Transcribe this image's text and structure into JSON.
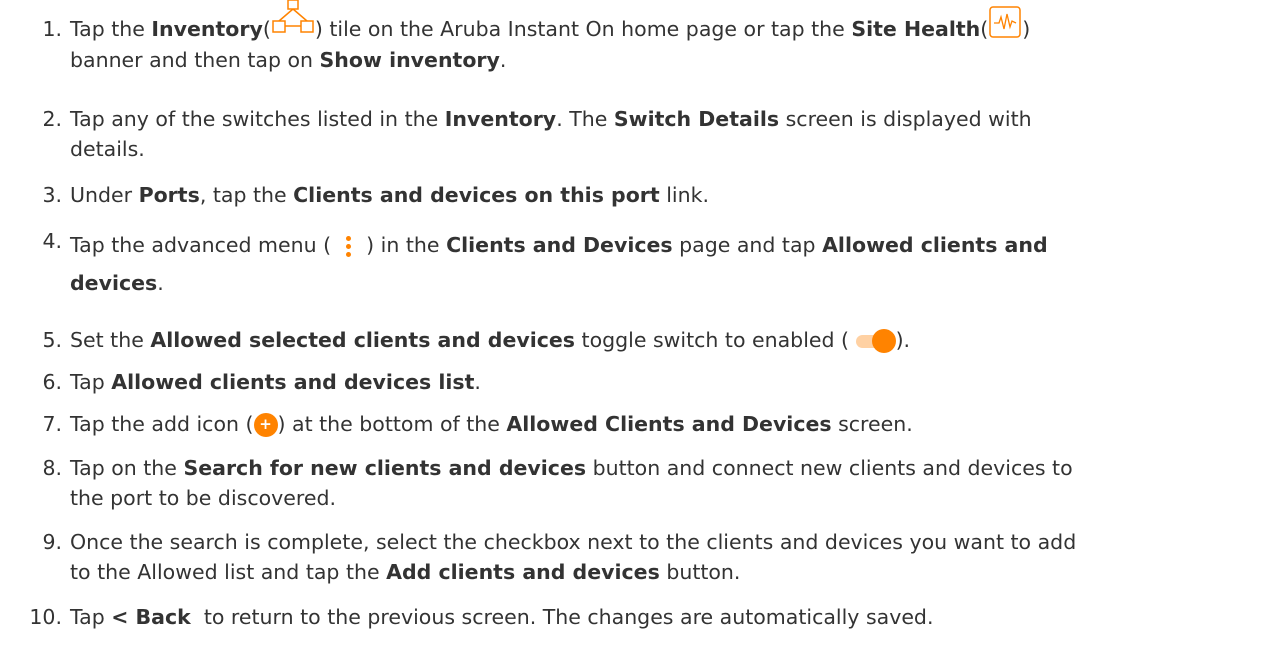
{
  "steps": [
    {
      "number": "1.",
      "parts": [
        "Tap the ",
        "Inventory",
        "(",
        ") tile on the Aruba Instant On home page or tap the ",
        "Site Health",
        "(",
        ")",
        "banner and then tap on ",
        "Show inventory",
        "."
      ]
    },
    {
      "number": "2.",
      "parts": [
        "Tap any of the switches listed in the ",
        "Inventory",
        ". The ",
        "Switch Details",
        " screen is displayed with",
        "details."
      ]
    },
    {
      "number": "3.",
      "parts": [
        "Under ",
        "Ports",
        ", tap the ",
        "Clients and devices on this port",
        " link."
      ]
    },
    {
      "number": "4.",
      "parts": [
        "Tap the advanced menu ( ",
        " ) in the ",
        "Clients and Devices",
        " page and tap ",
        "Allowed clients and",
        "devices",
        "."
      ]
    },
    {
      "number": "5.",
      "parts": [
        "Set the ",
        "Allowed selected clients and devices",
        " toggle switch to enabled ( ",
        ")."
      ]
    },
    {
      "number": "6.",
      "parts": [
        "Tap ",
        "Allowed clients and devices list",
        "."
      ]
    },
    {
      "number": "7.",
      "parts": [
        "Tap the add icon (",
        ") at the bottom of the ",
        "Allowed Clients and Devices",
        " screen."
      ]
    },
    {
      "number": "8.",
      "parts": [
        "Tap on the ",
        "Search for new clients and devices",
        " button and connect new clients and devices to",
        "the port to be discovered."
      ]
    },
    {
      "number": "9.",
      "parts": [
        "Once the search is complete, select the checkbox next to the clients and devices you want to add",
        "to the Allowed list and tap the ",
        "Add clients and devices",
        " button."
      ]
    },
    {
      "number": "10.",
      "parts": [
        "Tap ",
        "< Back",
        "  to return to the previous screen. The changes are automatically saved."
      ]
    }
  ],
  "icons": {
    "inventory": "inventory-icon",
    "site_health": "site-health-icon",
    "advanced_menu": "kebab-menu-icon",
    "toggle": "toggle-on-icon",
    "add": "add-icon",
    "add_glyph": "+"
  },
  "colors": {
    "accent": "#ff8300",
    "text": "#333333",
    "toggle_track": "#ffd1a3"
  }
}
